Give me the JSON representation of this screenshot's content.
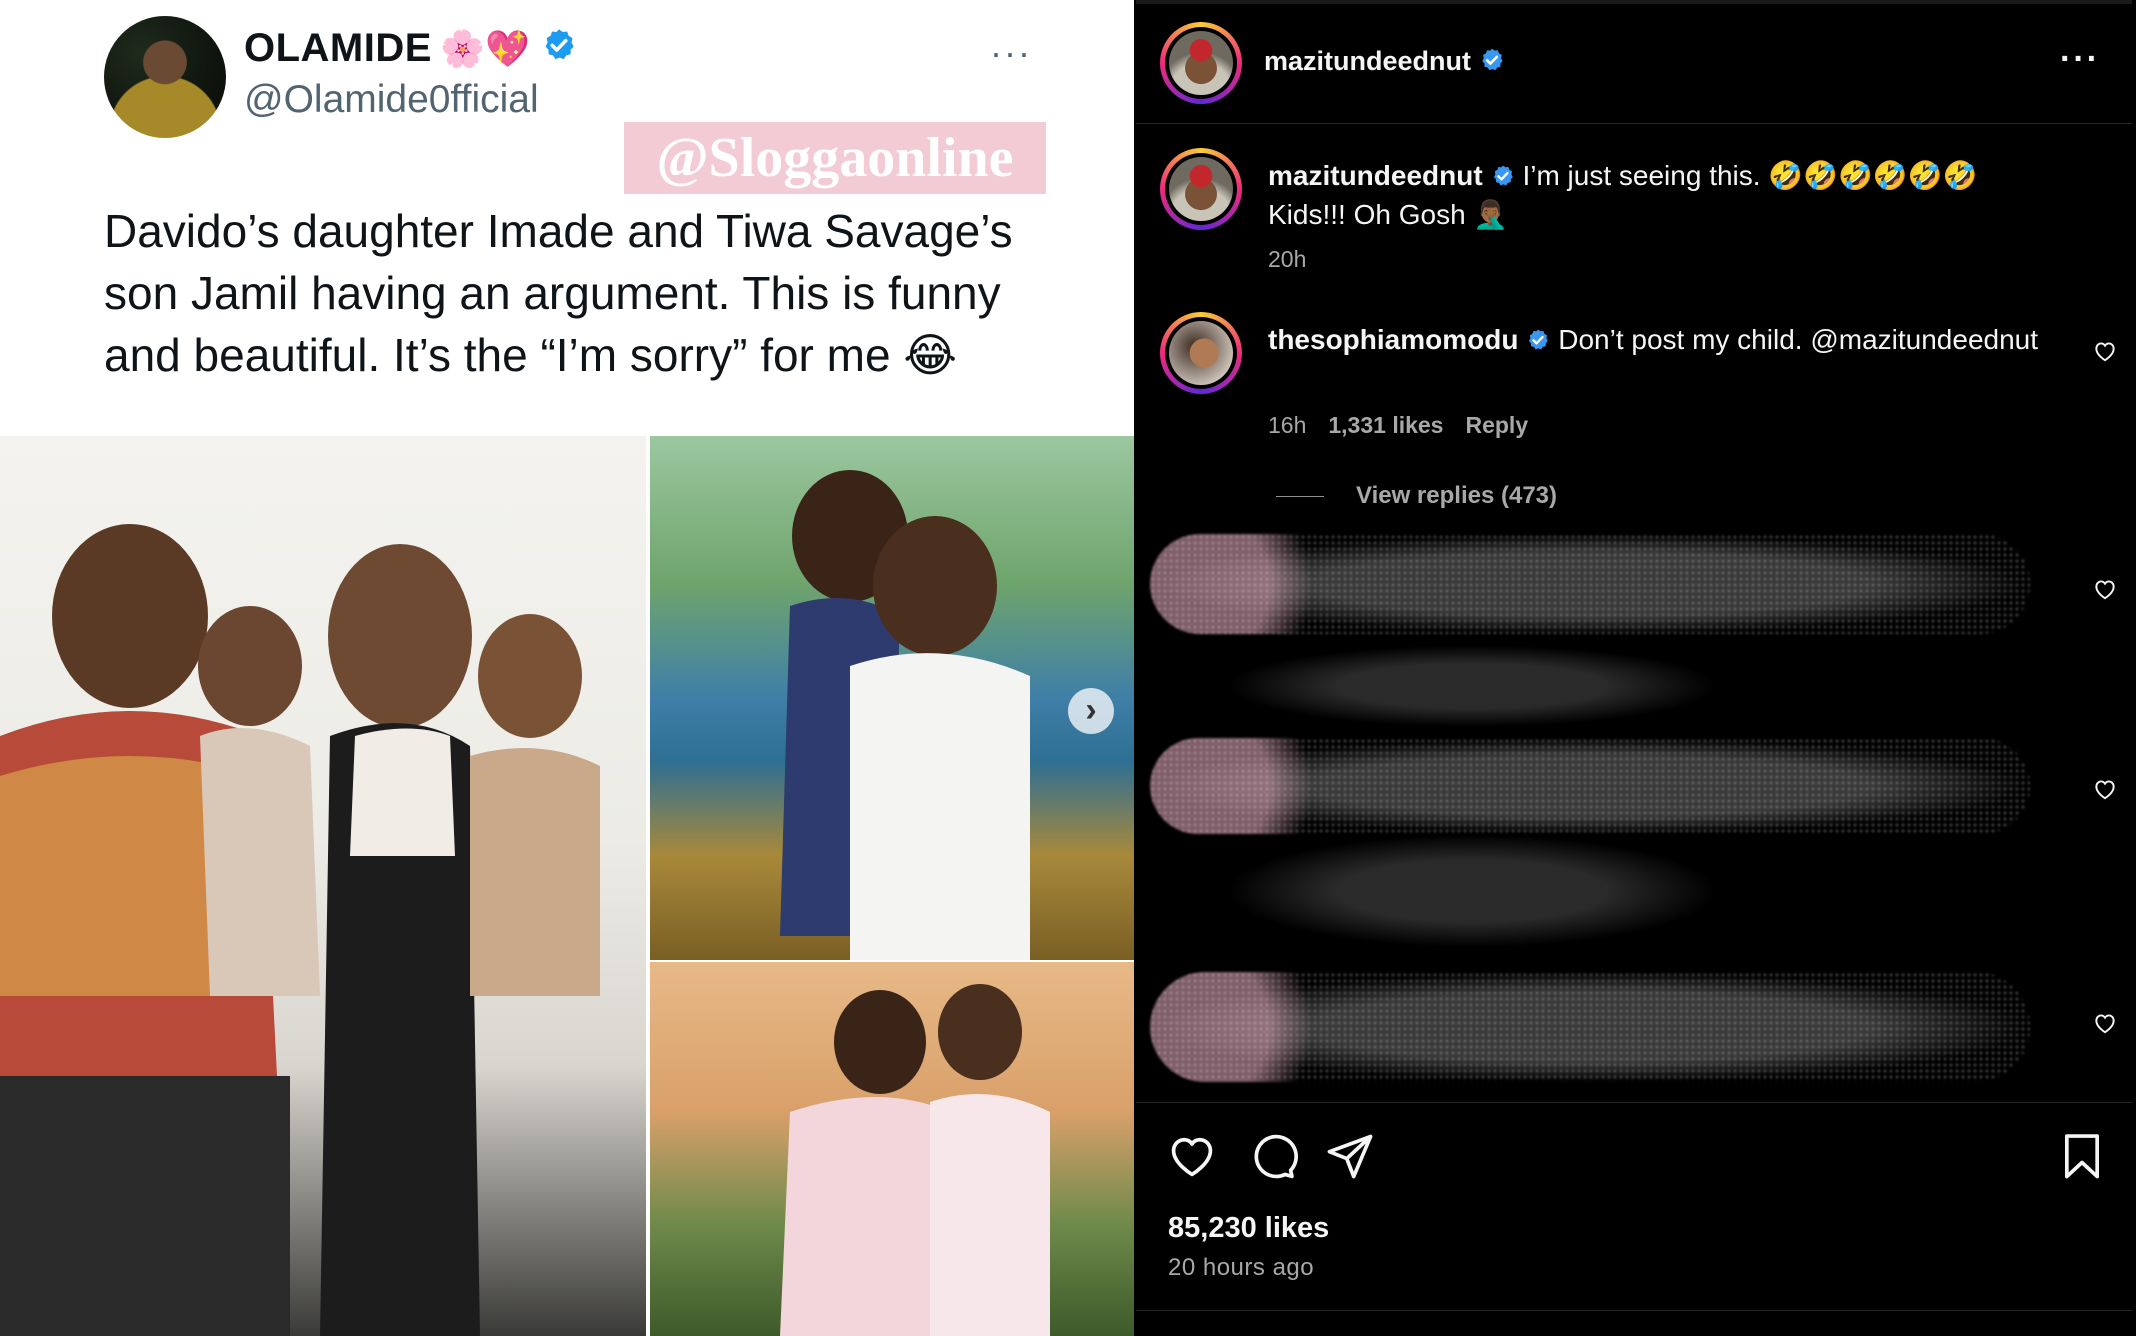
{
  "tweet": {
    "author_name": "OLAMIDE",
    "author_emoji": "🌸💖",
    "author_handle": "@Olamide0fficial",
    "more_label": "···",
    "watermark": "@Sloggaonline",
    "text": "Davido’s daughter Imade and Tiwa Savage’s son Jamil having an argument. This is funny and beautiful. It’s the “I’m sorry” for me 😂",
    "next_label": "›"
  },
  "instagram": {
    "header_username": "mazitundeednut",
    "more_label": "···",
    "caption": {
      "username": "mazitundeednut",
      "text": "I’m just seeing this. 🤣🤣🤣🤣🤣🤣 Kids!!! Oh Gosh 🤦🏾‍♂️",
      "time": "20h"
    },
    "comment": {
      "username": "thesophiamomodu",
      "text": "Don’t post my child. @mazitundeednut",
      "time": "16h",
      "likes": "1,331 likes",
      "reply_label": "Reply",
      "view_replies": "View replies (473)"
    },
    "likes": "85,230 likes",
    "posted_ago": "20 hours ago"
  },
  "colors": {
    "verified_blue": "#1d9bf0",
    "ig_verified_blue": "#3897f0",
    "ig_background": "#000000",
    "tweet_background": "#ffffff"
  },
  "icons": [
    "verified-badge-icon",
    "more-icon",
    "heart-icon",
    "comment-icon",
    "share-icon",
    "bookmark-icon",
    "chevron-right-icon"
  ]
}
